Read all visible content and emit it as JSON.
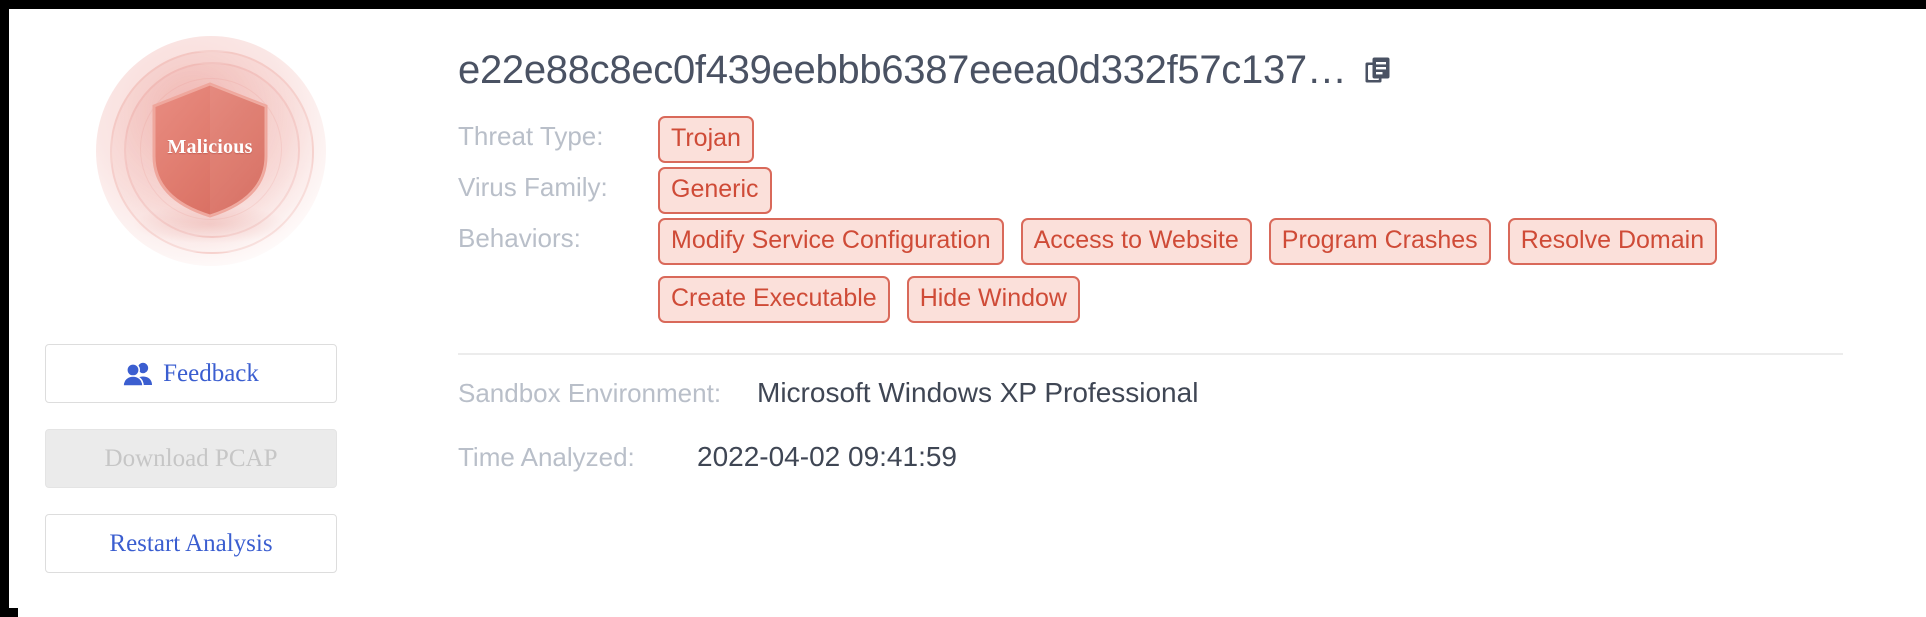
{
  "verdict": {
    "label": "Malicious",
    "icon": "shield-icon",
    "color": "#d9695a"
  },
  "sidebar": {
    "buttons": [
      {
        "label": "Feedback",
        "icon": "people-icon",
        "disabled": false
      },
      {
        "label": "Download PCAP",
        "icon": null,
        "disabled": true
      },
      {
        "label": "Restart Analysis",
        "icon": null,
        "disabled": false
      }
    ]
  },
  "header": {
    "hash": "e22e88c8ec0f439eebbb6387eeea0d332f57c137…",
    "copy_icon": "copy-icon"
  },
  "details": {
    "threat_type_label": "Threat Type:",
    "threat_type_tags": [
      "Trojan"
    ],
    "virus_family_label": "Virus Family:",
    "virus_family_tags": [
      "Generic"
    ],
    "behaviors_label": "Behaviors:",
    "behaviors_tags": [
      "Modify Service Configuration",
      "Access to Website",
      "Program Crashes",
      "Resolve Domain",
      "Create Executable",
      "Hide Window"
    ]
  },
  "environment": {
    "sandbox_label": "Sandbox Environment:",
    "sandbox_value": "Microsoft Windows XP Professional",
    "time_label": "Time Analyzed:",
    "time_value": "2022-04-02 09:41:59"
  },
  "colors": {
    "tag_border": "#d9695a",
    "tag_bg": "#fbe0da",
    "tag_text": "#cf4b37",
    "link_blue": "#3b5ed0",
    "label_gray": "#b9bfc9",
    "value_dark": "#3f4654"
  }
}
